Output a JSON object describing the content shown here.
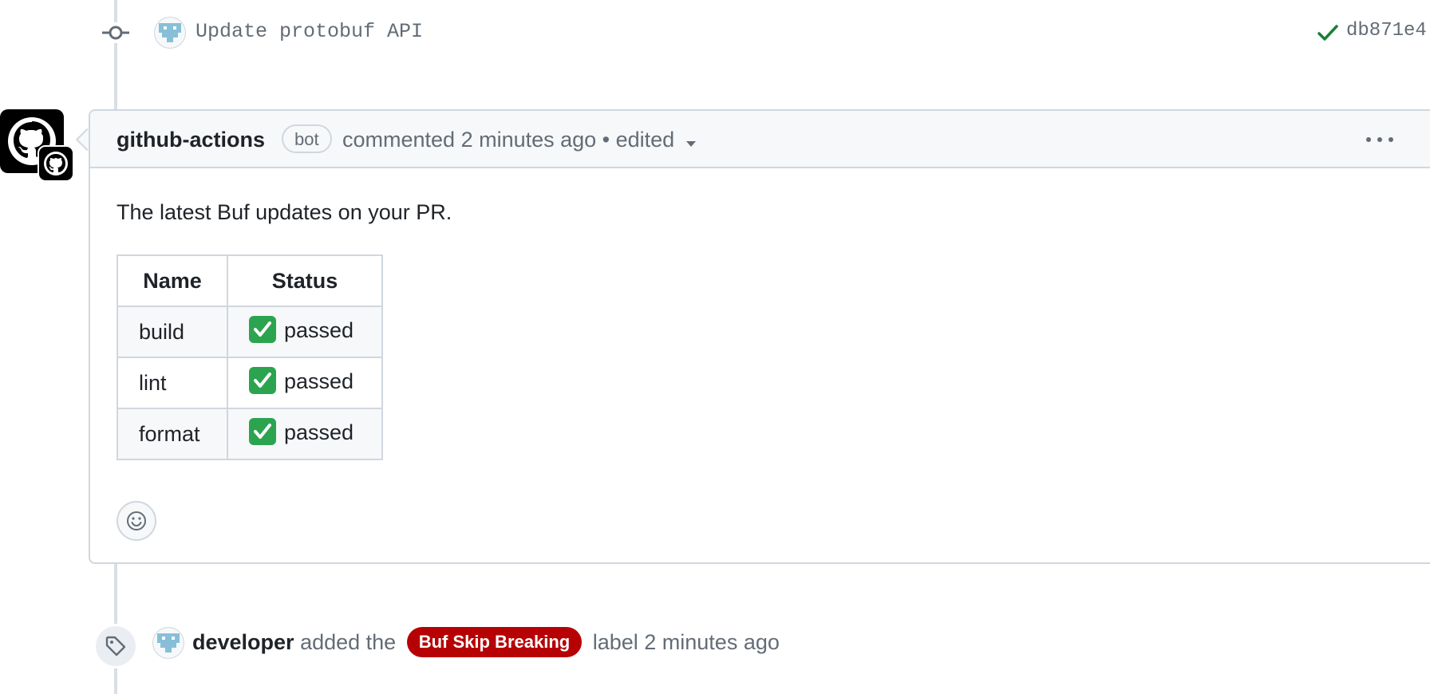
{
  "commit": {
    "message": "Update protobuf API",
    "sha": "db871e4",
    "status_icon": "check-icon"
  },
  "comment": {
    "author": "github-actions",
    "badge": "bot",
    "meta": "commented 2 minutes ago • edited",
    "body": "The latest Buf updates on your PR.",
    "table": {
      "headers": [
        "Name",
        "Status"
      ],
      "rows": [
        {
          "name": "build",
          "status": "passed"
        },
        {
          "name": "lint",
          "status": "passed"
        },
        {
          "name": "format",
          "status": "passed"
        }
      ]
    }
  },
  "label_event": {
    "actor": "developer",
    "text_before": "added the",
    "label": "Buf Skip Breaking",
    "text_after": "label 2 minutes ago",
    "label_color": "#b60205"
  },
  "colors": {
    "muted_text": "#636c76",
    "border": "#d0d7de",
    "success": "#1a7f37"
  }
}
